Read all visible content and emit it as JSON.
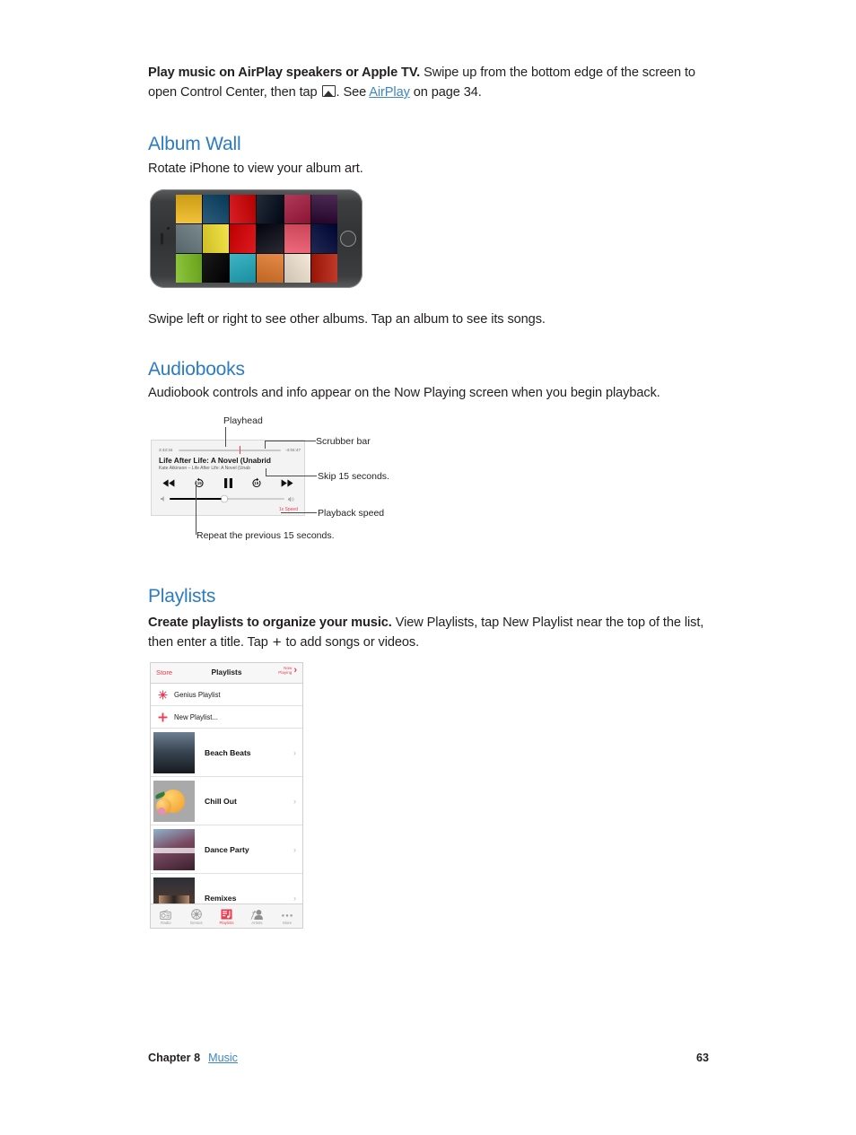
{
  "intro": {
    "bold": "Play music on AirPlay speakers or Apple TV.",
    "text_1": " Swipe up from the bottom edge of the screen to open Control Center, then tap ",
    "icon": "airplay-icon",
    "text_2": ". See ",
    "link": "AirPlay",
    "text_3": " on page 34."
  },
  "album_wall": {
    "heading": "Album Wall",
    "subtitle": "Rotate iPhone to view your album art.",
    "caption": "Swipe left or right to see other albums. Tap an album to see its songs.",
    "figure_alt": "iPhone in landscape showing a grid of album artwork",
    "grid_colors": [
      "#f2c23a",
      "#2d5d7c",
      "#d91f26",
      "#232c3a",
      "#b13a5a",
      "#4b2b52",
      "#7b8a8f",
      "#f2e44a",
      "#e01a22",
      "#2a2a34",
      "#f06a7e",
      "#1f2a55",
      "#8ec63f",
      "#1a1a1a",
      "#3fb4c4",
      "#e58b4a",
      "#f4e9d8",
      "#c03a2b"
    ]
  },
  "audiobooks": {
    "heading": "Audiobooks",
    "subtitle": "Audiobook controls and info appear on the Now Playing screen when you begin playback.",
    "player": {
      "elapsed": "3:43:34",
      "remaining": "-4:04:47",
      "title": "Life After Life: A Novel (Unabrid",
      "subtitle": "Kate Atkinson – Life After Life: A Novel (Unab",
      "speed": "1x Speed",
      "skip_back_label": "15",
      "skip_fwd_label": "15"
    },
    "callouts": {
      "playhead": "Playhead",
      "scrubber": "Scrubber bar",
      "skip": "Skip 15 seconds.",
      "speed": "Playback speed",
      "repeat": "Repeat the previous 15 seconds."
    }
  },
  "playlists": {
    "heading": "Playlists",
    "body_bold": "Create playlists to organize your music.",
    "body_1": " View Playlists, tap New Playlist near the top of the list, then enter a title. Tap ",
    "body_plus": "+",
    "body_2": " to add songs or videos.",
    "screen": {
      "nav": {
        "left": "Store",
        "title": "Playlists",
        "right_line1": "Now",
        "right_line2": "Playing"
      },
      "rows": [
        {
          "label": "Genius Playlist",
          "icon": "genius-icon"
        },
        {
          "label": "New Playlist...",
          "icon": "plus-icon"
        }
      ],
      "items": [
        {
          "name": "Beach Beats",
          "art": "#30394a"
        },
        {
          "name": "Chill Out",
          "art": "#a9a9a9"
        },
        {
          "name": "Dance Party",
          "art": "#6b3a52"
        },
        {
          "name": "Remixes",
          "art": "#2b3038"
        }
      ],
      "tabs": [
        {
          "label": "Radio",
          "icon": "radio-icon",
          "active": false
        },
        {
          "label": "Genius",
          "icon": "genius-icon",
          "active": false
        },
        {
          "label": "Playlists",
          "icon": "playlists-icon",
          "active": true
        },
        {
          "label": "Artists",
          "icon": "artists-icon",
          "active": false
        },
        {
          "label": "More",
          "icon": "more-icon",
          "active": false
        }
      ]
    }
  },
  "footer": {
    "chapter": "Chapter  8",
    "section": "Music",
    "page": "63"
  },
  "colors": {
    "heading_blue": "#2b7cc2",
    "link_blue": "#3b87c8",
    "ios_red": "#f13a4e",
    "playhead_red": "#ee3b54",
    "body_text": "#231f20"
  }
}
